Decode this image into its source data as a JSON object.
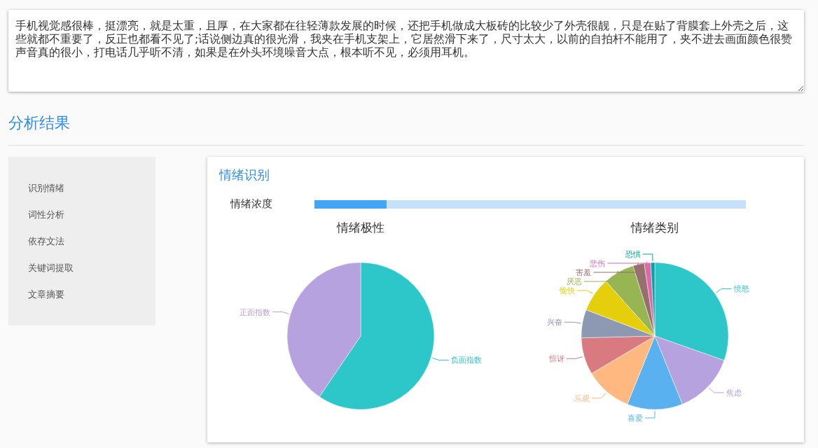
{
  "input": {
    "value": "手机视觉感很棒，挺漂亮，就是太重，且厚，在大家都在往轻薄款发展的时候，还把手机做成大板砖的比较少了外壳很靓，只是在贴了背膜套上外壳之后，这些就都不重要了，反正也都看不见了;话说侧边真的很光滑，我夹在手机支架上，它居然滑下来了，尺寸太大，以前的自拍杆不能用了，夹不进去画面颜色很赞声音真的很小，打电话几乎听不清，如果是在外头环境噪音大点，根本听不见，必须用耳机。"
  },
  "heading": "分析结果",
  "sidebar": {
    "items": [
      {
        "label": "识别情绪"
      },
      {
        "label": "词性分析"
      },
      {
        "label": "依存文法"
      },
      {
        "label": "关键词提取"
      },
      {
        "label": "文章摘要"
      }
    ]
  },
  "panel": {
    "title": "情绪识别",
    "intensity": {
      "label": "情绪浓度",
      "level": 0.167
    },
    "charts": [
      {
        "chart_data": {
          "type": "pie",
          "title": "情绪极性",
          "categories": [
            "负面指数",
            "正面指数"
          ],
          "values": [
            59.5,
            40.5
          ],
          "colors": [
            "#2ec7c9",
            "#b6a2de"
          ]
        }
      },
      {
        "chart_data": {
          "type": "pie",
          "title": "情绪类别",
          "categories": [
            "愤怒",
            "焦虑",
            "喜爱",
            "乐观",
            "惊讶",
            "兴奋",
            "愉快",
            "厌恶",
            "害羞",
            "悲伤",
            "恐惧"
          ],
          "values": [
            30.4,
            13.5,
            12.2,
            10.4,
            8.1,
            6.2,
            7.6,
            6.8,
            2.5,
            1.4,
            0.9
          ],
          "colors": [
            "#2ec7c9",
            "#b6a2de",
            "#5ab1ef",
            "#ffb980",
            "#d87a80",
            "#8d98b3",
            "#e5cf0d",
            "#97b552",
            "#95706d",
            "#dc69aa",
            "#07a2a4"
          ]
        }
      }
    ]
  }
}
